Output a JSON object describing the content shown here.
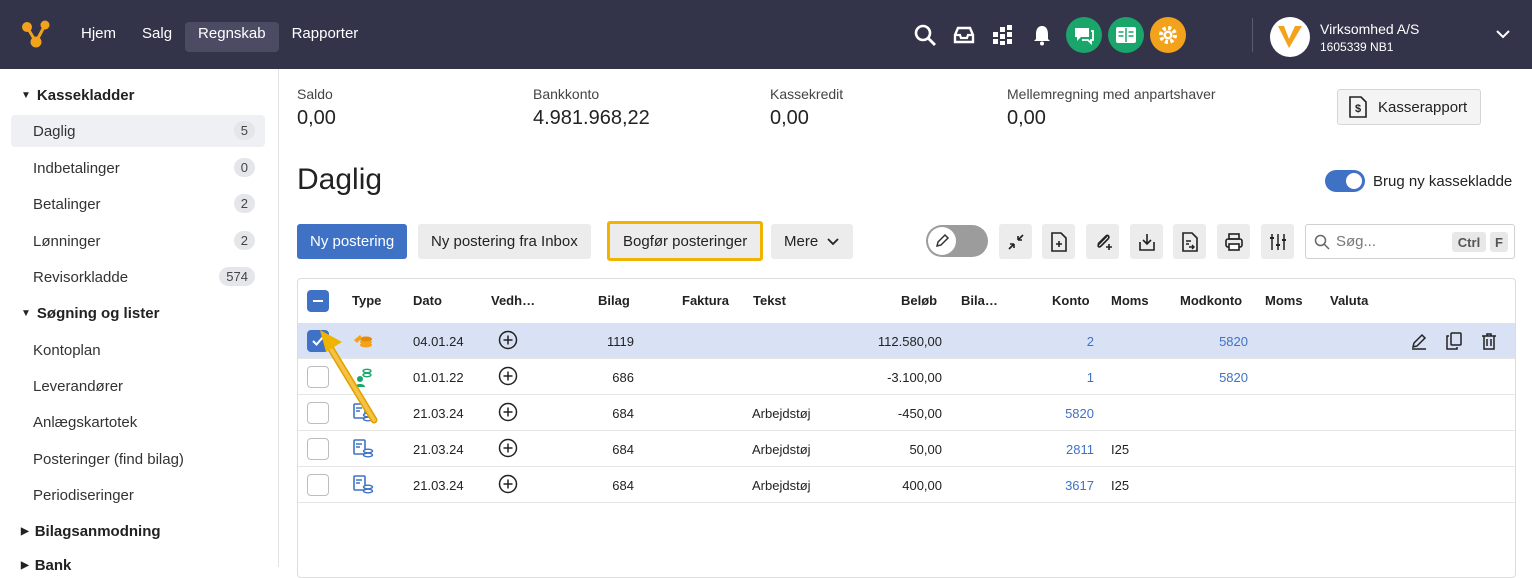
{
  "nav": {
    "items": [
      "Hjem",
      "Salg",
      "Regnskab",
      "Rapporter"
    ],
    "active": "Regnskab"
  },
  "company": {
    "name": "Virksomhed A/S",
    "id": "1605339 NB1"
  },
  "colors": {
    "topbar": "#33344a",
    "primary": "#3f72c5",
    "highlight": "#f0b400",
    "green": "#1aa56a",
    "orange": "#f3a21b"
  },
  "sidebar": {
    "sections": [
      {
        "label": "Kassekladder",
        "expanded": true
      },
      {
        "label": "Søgning og lister",
        "expanded": true
      },
      {
        "label": "Bilagsanmodning",
        "expanded": false
      },
      {
        "label": "Bank",
        "expanded": false
      }
    ],
    "kasse_items": [
      {
        "label": "Daglig",
        "count": "5"
      },
      {
        "label": "Indbetalinger",
        "count": "0"
      },
      {
        "label": "Betalinger",
        "count": "2"
      },
      {
        "label": "Lønninger",
        "count": "2"
      },
      {
        "label": "Revisorkladde",
        "count": "574"
      }
    ],
    "search_items": [
      "Kontoplan",
      "Leverandører",
      "Anlægskartotek",
      "Posteringer (find bilag)",
      "Periodiseringer"
    ]
  },
  "stats": [
    {
      "label": "Saldo",
      "value": "0,00"
    },
    {
      "label": "Bankkonto",
      "value": "4.981.968,22"
    },
    {
      "label": "Kassekredit",
      "value": "0,00"
    },
    {
      "label": "Mellemregning med anpartshaver",
      "value": "0,00"
    }
  ],
  "kasserapport_label": "Kasserapport",
  "page_title": "Daglig",
  "toggle_label": "Brug ny kassekladde",
  "toolbar": {
    "new_label": "Ny postering",
    "inbox_label": "Ny postering fra Inbox",
    "bogfor_label": "Bogfør posteringer",
    "more_label": "Mere"
  },
  "search": {
    "placeholder": "Søg...",
    "kbd1": "Ctrl",
    "kbd2": "F"
  },
  "table": {
    "headers": [
      "Type",
      "Dato",
      "Vedh…",
      "Bilag",
      "Faktura",
      "Tekst",
      "Beløb",
      "Bila…",
      "Konto",
      "Moms",
      "Modkonto",
      "Moms",
      "Valuta"
    ],
    "rows": [
      {
        "type_icon": "coins-icon",
        "date": "04.01.24",
        "bilag": "1119",
        "tekst": "",
        "belob": "112.580,00",
        "konto": "2",
        "moms": "",
        "modkonto": "5820",
        "checked": true
      },
      {
        "type_icon": "person-coins-icon",
        "date": "01.01.22",
        "bilag": "686",
        "tekst": "",
        "belob": "-3.100,00",
        "konto": "1",
        "moms": "",
        "modkonto": "5820",
        "checked": false
      },
      {
        "type_icon": "ledger-icon",
        "date": "21.03.24",
        "bilag": "684",
        "tekst": "Arbejdstøj",
        "belob": "-450,00",
        "konto": "5820",
        "moms": "",
        "modkonto": "",
        "checked": false
      },
      {
        "type_icon": "ledger-icon",
        "date": "21.03.24",
        "bilag": "684",
        "tekst": "Arbejdstøj",
        "belob": "50,00",
        "konto": "2811",
        "moms": "I25",
        "modkonto": "",
        "checked": false
      },
      {
        "type_icon": "ledger-icon",
        "date": "21.03.24",
        "bilag": "684",
        "tekst": "Arbejdstøj",
        "belob": "400,00",
        "konto": "3617",
        "moms": "I25",
        "modkonto": "",
        "checked": false
      }
    ]
  }
}
